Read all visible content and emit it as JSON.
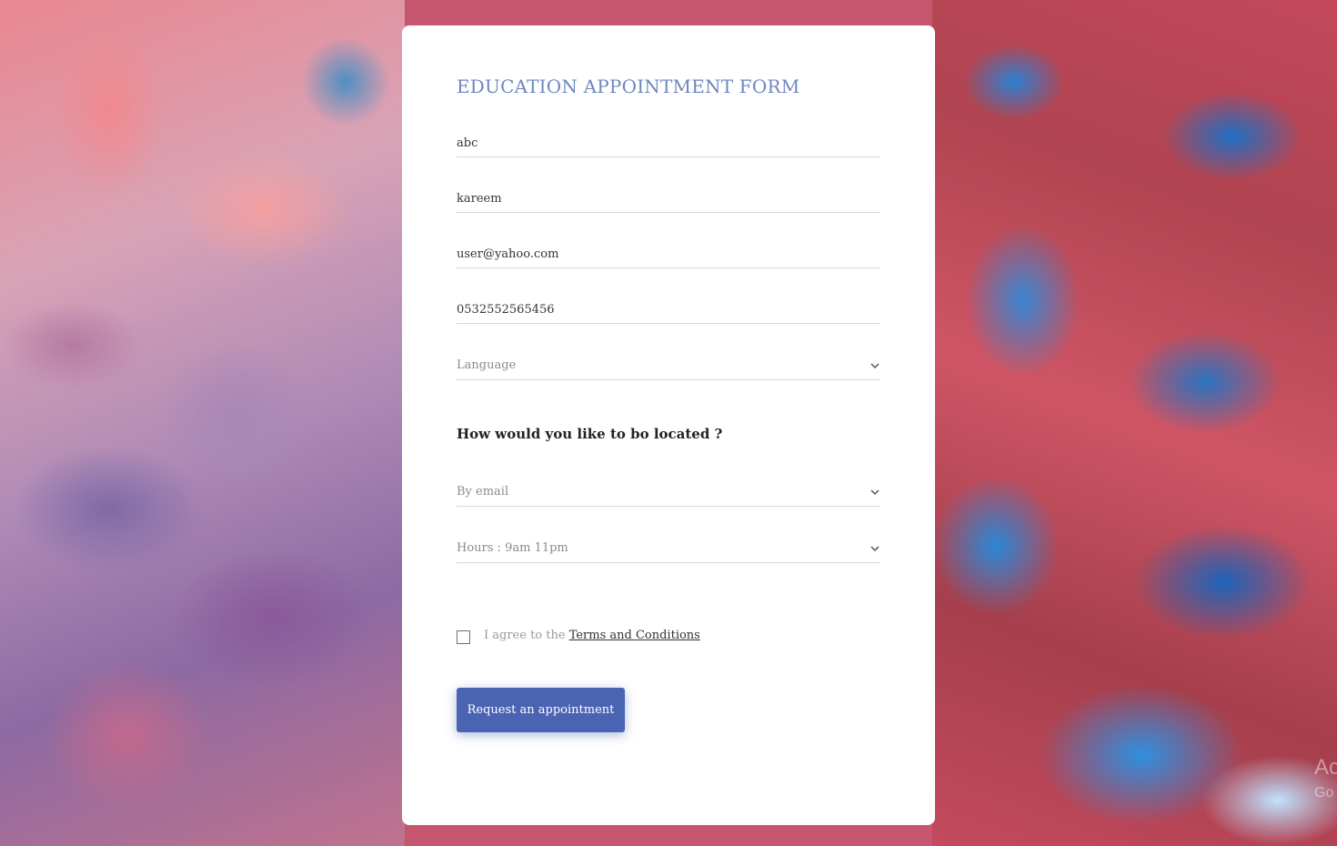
{
  "form": {
    "title": "EDUCATION APPOINTMENT FORM",
    "fields": {
      "name": "abc",
      "last_name": "kareem",
      "email": "user@yahoo.com",
      "phone": "0532552565456"
    },
    "language_select": "Language",
    "question": "How would you like to bo located ?",
    "contact_method_select": "By email",
    "hours_select": "Hours : 9am 11pm",
    "agree_prefix": "I agree to the ",
    "terms_link": "Terms and Conditions",
    "submit_label": "Request an appointment"
  },
  "watermark": {
    "line1": "Ac",
    "line2": "Go"
  },
  "colors": {
    "title": "#6f86bd",
    "button": "#4a63b3",
    "card": "#ffffff"
  },
  "icons": {
    "select_arrow": "chevron-down-icon"
  }
}
